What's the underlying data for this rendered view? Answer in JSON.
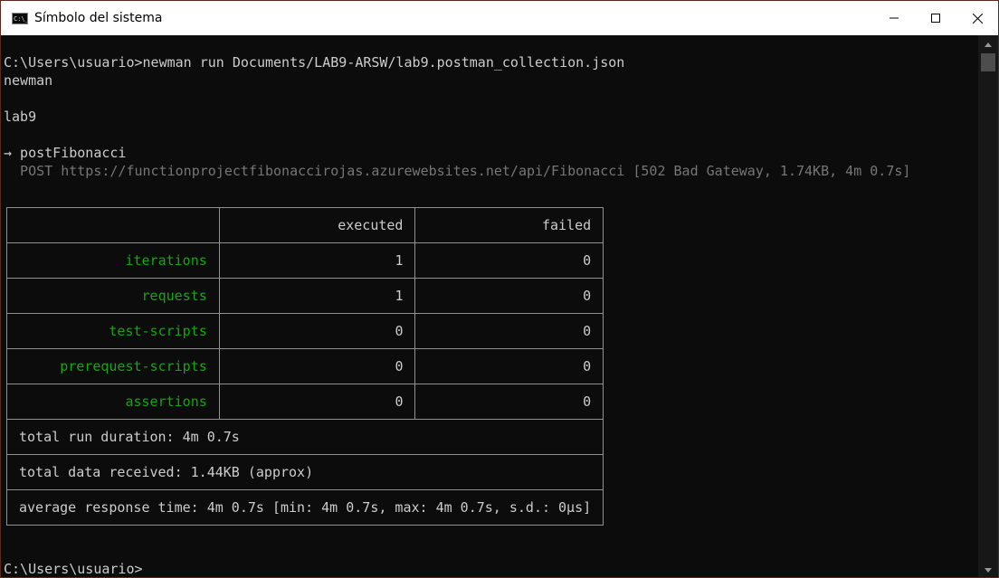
{
  "window": {
    "title": "Símbolo del sistema",
    "icon": "cmd-icon"
  },
  "console": {
    "command_line": "C:\\Users\\usuario>newman run Documents/LAB9-ARSW/lab9.postman_collection.json",
    "tool_name": "newman",
    "collection_name": "lab9",
    "request_name": "→ postFibonacci",
    "request_detail": "  POST https://functionprojectfibonaccirojas.azurewebsites.net/api/Fibonacci [502 Bad Gateway, 1.74KB, 4m 0.7s]",
    "prompt_line": "C:\\Users\\usuario>"
  },
  "summary": {
    "headers": [
      "",
      "executed",
      "failed"
    ],
    "rows": [
      {
        "metric": "iterations",
        "executed": "1",
        "failed": "0"
      },
      {
        "metric": "requests",
        "executed": "1",
        "failed": "0"
      },
      {
        "metric": "test-scripts",
        "executed": "0",
        "failed": "0"
      },
      {
        "metric": "prerequest-scripts",
        "executed": "0",
        "failed": "0"
      },
      {
        "metric": "assertions",
        "executed": "0",
        "failed": "0"
      }
    ],
    "total_run_duration": "total run duration: 4m 0.7s",
    "total_data_received": "total data received: 1.44KB (approx)",
    "average_response_time": "average response time: 4m 0.7s [min: 4m 0.7s, max: 4m 0.7s, s.d.: 0µs]"
  },
  "colors": {
    "background": "#0c0c0c",
    "text": "#cccccc",
    "metric_green": "#16a40f",
    "detail_gray": "#767676"
  }
}
